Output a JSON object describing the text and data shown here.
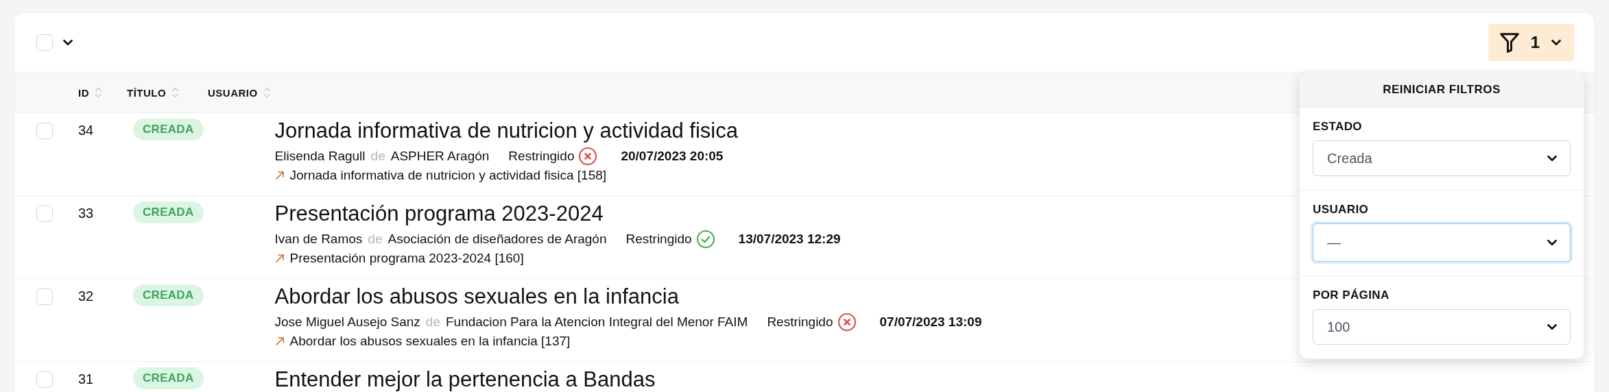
{
  "toolbar": {
    "select_all_checked": false,
    "filter_count": "1"
  },
  "table": {
    "columns": [
      {
        "label": "ID"
      },
      {
        "label": "TÍTULO"
      },
      {
        "label": "USUARIO"
      }
    ],
    "rows": [
      {
        "checked": false,
        "id": "34",
        "status": "CREADA",
        "title": "Jornada informativa de nutricion y actividad fisica",
        "byline": [
          {
            "kind": "user",
            "text": "Elisenda Ragull"
          },
          {
            "kind": "connector",
            "text": "de"
          },
          {
            "kind": "org",
            "text": "ASPHER Aragón"
          },
          {
            "kind": "access",
            "text": "Restringido",
            "approved": false
          },
          {
            "kind": "date",
            "text": "20/07/2023 20:05"
          }
        ],
        "link": "Jornada informativa de nutricion y actividad fisica [158]"
      },
      {
        "checked": false,
        "id": "33",
        "status": "CREADA",
        "title": "Presentación programa 2023-2024",
        "byline": [
          {
            "kind": "user",
            "text": "Ivan de Ramos"
          },
          {
            "kind": "connector",
            "text": "de"
          },
          {
            "kind": "org",
            "text": "Asociación de diseñadores de Aragón"
          },
          {
            "kind": "access",
            "text": "Restringido",
            "approved": true
          },
          {
            "kind": "date",
            "text": "13/07/2023 12:29"
          }
        ],
        "link": "Presentación programa 2023-2024 [160]"
      },
      {
        "checked": false,
        "id": "32",
        "status": "CREADA",
        "title": "Abordar los abusos sexuales en la infancia",
        "byline": [
          {
            "kind": "user",
            "text": "Jose Miguel Ausejo Sanz"
          },
          {
            "kind": "connector",
            "text": "de"
          },
          {
            "kind": "org",
            "text": "Fundacion Para la Atencion Integral del Menor FAIM"
          },
          {
            "kind": "access",
            "text": "Restringido",
            "approved": false
          },
          {
            "kind": "date",
            "text": "07/07/2023 13:09"
          }
        ],
        "link": "Abordar los abusos sexuales en la infancia [137]"
      },
      {
        "checked": false,
        "id": "31",
        "status": "CREADA",
        "title": "Entender mejor la pertenencia a Bandas"
      }
    ]
  },
  "filter_panel": {
    "reset": "REINICIAR FILTROS",
    "fields": [
      {
        "label": "ESTADO",
        "value": "Creada",
        "focused": false
      },
      {
        "label": "USUARIO",
        "value": "—",
        "focused": true
      },
      {
        "label": "POR PÁGINA",
        "value": "100",
        "focused": false
      }
    ]
  }
}
